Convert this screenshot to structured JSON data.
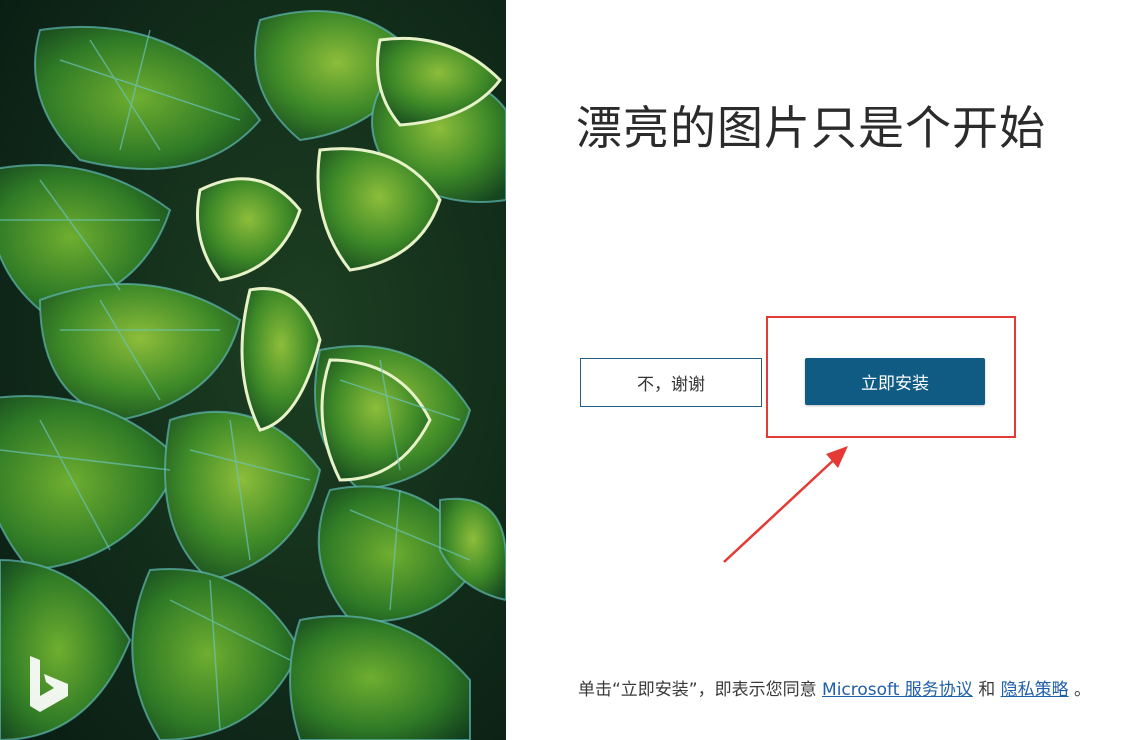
{
  "headline": "漂亮的图片只是个开始",
  "buttons": {
    "decline_label": "不，谢谢",
    "install_label": "立即安装"
  },
  "legal": {
    "prefix": "单击“立即安装”，即表示您同意 ",
    "services_link": "Microsoft 服务协议",
    "and_text": " 和 ",
    "privacy_link": "隐私策略",
    "suffix": " 。"
  },
  "icons": {
    "logo": "bing-logo-icon",
    "annotation": "red-arrow-icon"
  },
  "colors": {
    "install_button": "#0f5b84",
    "decline_border": "#1f5f86",
    "highlight_box": "#e53935",
    "link": "#1f5fa8",
    "leaf_green": "#3f8f2a",
    "leaf_dark": "#123a20",
    "leaf_vein": "#4fb0b0"
  }
}
